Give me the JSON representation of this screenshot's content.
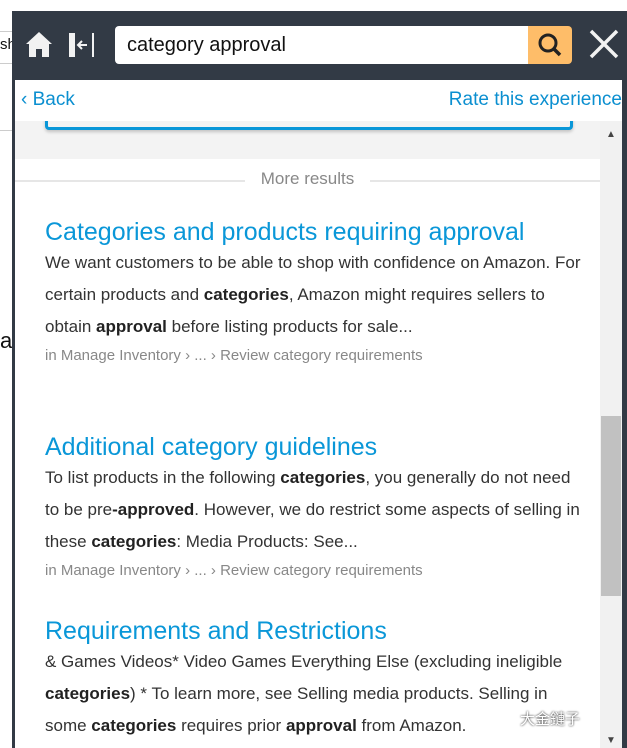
{
  "background": {
    "text1": "sh",
    "text2": "at"
  },
  "header": {
    "search_value": "category approval"
  },
  "nav": {
    "back": "Back",
    "rate": "Rate this experience"
  },
  "more_results": "More results",
  "results": [
    {
      "title": "Categories and products requiring approval",
      "body_html": "We want customers to be able to shop with confidence on Amazon. For certain products and <b>categories</b>, Amazon might requires sellers to obtain <b>approval</b> before listing products for sale...",
      "path": "in Manage Inventory › ... › Review category requirements"
    },
    {
      "title": "Additional category guidelines",
      "body_html": "To list products in the following <b>categories</b>, you generally do not need to be pre<b>-approved</b>. However, we do restrict some aspects of selling in these <b>categories</b>: Media Products: See...",
      "path": "in Manage Inventory › ... › Review category requirements"
    },
    {
      "title": "Requirements and Restrictions",
      "body_html": "&amp; Games Videos* Video Games Everything Else (excluding ineligible <b>categories</b>) * To learn more, see Selling media products. Selling in some <b>categories</b> requires prior <b>approval</b> from Amazon.",
      "path": ""
    }
  ],
  "watermark": "大金鏈子",
  "colors": {
    "header_bg": "#323a45",
    "search_button": "#febd69",
    "link": "#0a97d8"
  }
}
